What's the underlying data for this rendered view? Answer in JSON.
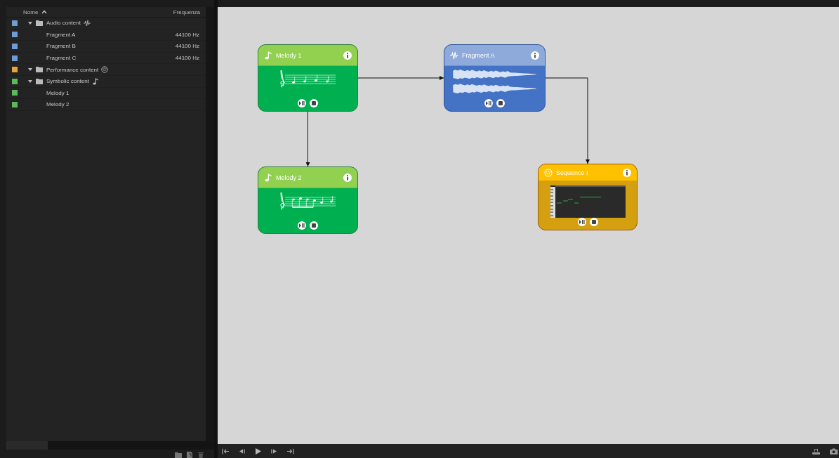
{
  "tree": {
    "columns": [
      "Nome",
      "Frequenza"
    ],
    "rows": [
      {
        "label": "Audio content",
        "kind": "audio",
        "color": "#6f9bd6",
        "expanded": true,
        "children": [
          {
            "label": "Fragment A",
            "frequency": "44100 Hz",
            "color": "#6f9bd6"
          },
          {
            "label": "Fragment B",
            "frequency": "44100 Hz",
            "color": "#6f9bd6"
          },
          {
            "label": "Fragment C",
            "frequency": "44100 Hz",
            "color": "#6f9bd6"
          }
        ]
      },
      {
        "label": "Performance content",
        "kind": "performance",
        "color": "#e8a33c",
        "expanded": true
      },
      {
        "label": "Symbolic content",
        "kind": "symbolic",
        "color": "#5cb85c",
        "expanded": true,
        "children": [
          {
            "label": "Melody 1",
            "color": "#5cb85c"
          },
          {
            "label": "Melody 2",
            "color": "#5cb85c"
          }
        ]
      }
    ]
  },
  "nodes": [
    {
      "title": "Melody 1",
      "kind": "symbolic"
    },
    {
      "title": "Fragment A",
      "kind": "audio"
    },
    {
      "title": "Melody 2",
      "kind": "symbolic"
    },
    {
      "title": "Sequence I",
      "kind": "performance"
    }
  ]
}
